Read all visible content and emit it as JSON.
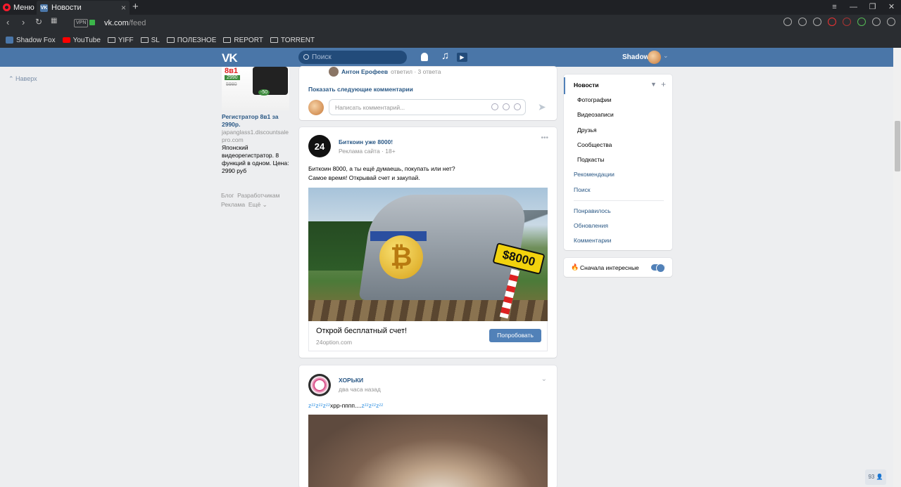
{
  "browser": {
    "menu_label": "Меню",
    "tab_title": "Новости",
    "url_domain": "vk.com",
    "url_path": "/feed",
    "vpn": "VPN",
    "new_tab": "+",
    "bookmarks": [
      "Shadow Fox",
      "YouTube",
      "YIFF",
      "SL",
      "ПОЛЕЗНОЕ",
      "REPORT",
      "TORRENT"
    ]
  },
  "vk": {
    "logo": "VK",
    "search_placeholder": "Поиск",
    "username": "Shadow"
  },
  "left": {
    "to_top": "Наверх",
    "ad": {
      "price_new": "2990",
      "price_old": "5980",
      "discount": "-50",
      "title": "Регистратор 8в1 за 2990р.",
      "domain": "japanglass1.discountsalepro.com",
      "desc": "Японский видеорегистратор. 8 функций в одном. Цена: 2990 руб"
    },
    "footer": [
      "Блог",
      "Разработчикам",
      "Реклама",
      "Ещё"
    ]
  },
  "comment_card": {
    "reply_author": "Антон Ерофеев",
    "reply_text": "ответил · 3 ответа",
    "show_more": "Показать следующие комментарии",
    "input_placeholder": "Написать комментарий..."
  },
  "ad_post": {
    "avatar_text": "24",
    "author": "Биткоин уже 8000!",
    "meta": "Реклама сайта · 18+",
    "text_line1": "Биткоин 8000, а ты ещё думаешь, покупать или нет?",
    "text_line2": "Самое время! Открывай счет и закупай.",
    "sign_text": "$8000",
    "cta_title": "Открой бесплатный счет!",
    "cta_domain": "24option.com",
    "cta_button": "Попробовать"
  },
  "post3": {
    "author": "ХОРЬКИ",
    "meta": "два часа назад",
    "text_z1": "zᶻᶻzᶻᶻzᶻᶻ",
    "text_mid": "хрр-пппп....",
    "text_z2": "zᶻᶻzᶻᶻzᶻᶻ"
  },
  "right_menu": {
    "items": [
      "Новости",
      "Фотографии",
      "Видеозаписи",
      "Друзья",
      "Сообщества",
      "Подкасты",
      "Рекомендации",
      "Поиск",
      "Понравилось",
      "Обновления",
      "Комментарии"
    ],
    "toggle_label": "Сначала интересные"
  },
  "counter": "93"
}
